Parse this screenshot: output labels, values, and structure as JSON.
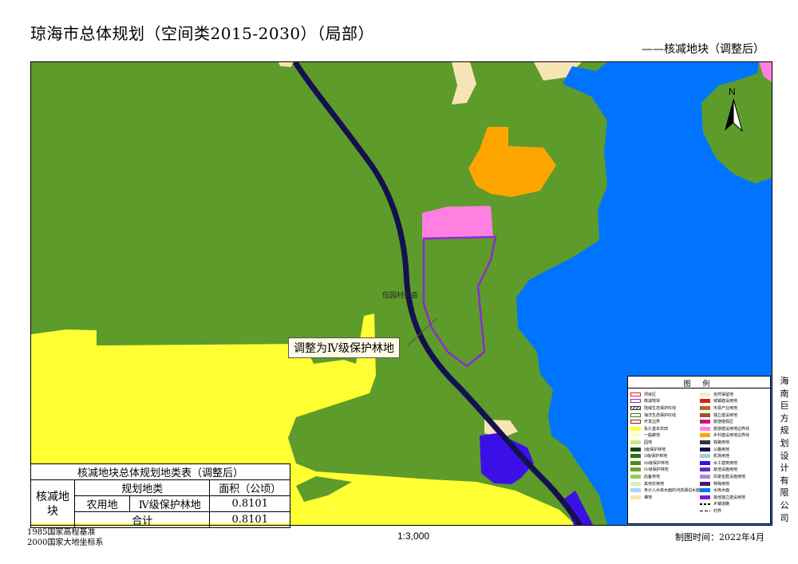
{
  "header": {
    "title": "琼海市总体规划（空间类2015-2030）（局部）",
    "subtitle": "——核减地块（调整后）"
  },
  "map": {
    "village_label": "伍园村委会",
    "callout": "调整为Ⅳ级保护林地",
    "north_label": "N",
    "colors": {
      "forest": "#5d9b2a",
      "water": "#0074ff",
      "farmland": "#ffff33",
      "orange": "#ffa500",
      "pink": "#ff80e0",
      "road": "#151050",
      "sand": "#f7e4b4",
      "boundary": "#8c2bd6",
      "blue_violet": "#3b10e8"
    }
  },
  "legend": {
    "title": "图 例",
    "left_items": [
      {
        "label": "项目区",
        "swatch": "outline-red"
      },
      {
        "label": "核减地块",
        "swatch": "outline-purple"
      },
      {
        "label": "陆域生态保护红线",
        "swatch": "hatch"
      },
      {
        "label": "海洋生态保护红线",
        "swatch": "outline-green"
      },
      {
        "label": "开发边界",
        "swatch": "outline-darkred"
      },
      {
        "label": "永久基本农田",
        "swatch": "#ffff33"
      },
      {
        "label": "一般耕地",
        "swatch": "#ffffbe"
      },
      {
        "label": "园地",
        "swatch": "#c8e98c"
      },
      {
        "label": "I级保护林地",
        "swatch": "#0f4a12"
      },
      {
        "label": "II级保护林地",
        "swatch": "#2e6e1c"
      },
      {
        "label": "III级保护林地",
        "swatch": "#4b8a25"
      },
      {
        "label": "IV级保护林地",
        "swatch": "#6aa52e"
      },
      {
        "label": "后备林地",
        "swatch": "#95cc5a"
      },
      {
        "label": "其他农用地",
        "swatch": "#d7eeb0"
      },
      {
        "label": "未计入水库水面的河流湖泊水面",
        "swatch": "#9fd8ff"
      },
      {
        "label": "裸地",
        "swatch": "#f7e4b4"
      }
    ],
    "right_items": [
      {
        "label": "自然保留地",
        "swatch": "#e8f5c8"
      },
      {
        "label": "城镇建设用地",
        "swatch": "#e31a1c"
      },
      {
        "label": "市县产业用地",
        "swatch": "#b5651d"
      },
      {
        "label": "独立建设用地",
        "swatch": "#a0522d"
      },
      {
        "label": "旅游度假区",
        "swatch": "#c71585"
      },
      {
        "label": "旅游建设用地边界线",
        "swatch": "#ff80e0"
      },
      {
        "label": "乡村建设用地边界线",
        "swatch": "#ffa500"
      },
      {
        "label": "铁路用地",
        "swatch": "#333333"
      },
      {
        "label": "公路用地",
        "swatch": "#151050"
      },
      {
        "label": "机场用地",
        "swatch": "#a6c8e0"
      },
      {
        "label": "水工建筑用地",
        "swatch": "#3b10e8"
      },
      {
        "label": "其他设施用地",
        "swatch": "#5a2bd6"
      },
      {
        "label": "风景名胜设施用地",
        "swatch": "#b083e0"
      },
      {
        "label": "特殊用地",
        "swatch": "#4b1870"
      },
      {
        "label": "水库水面",
        "swatch": "#0074ff"
      },
      {
        "label": "其他独立建设用地",
        "swatch": "#7a1fd6"
      },
      {
        "label": "乡镇道路",
        "swatch": "dash-thick"
      },
      {
        "label": "村界",
        "swatch": "dash-thin"
      }
    ]
  },
  "company": [
    "海",
    "南",
    "巨",
    "方",
    "规",
    "划",
    "设",
    "计",
    "有",
    "限",
    "公",
    "司"
  ],
  "table": {
    "title": "核减地块总体规划地类表（调整后）",
    "col_header_left": "核减地块",
    "col_header_class": "规划地类",
    "col_header_area": "面积（公顷）",
    "row_category": "农用地",
    "row_subcategory": "Ⅳ级保护林地",
    "row_area": "0.8101",
    "total_label": "合计",
    "total_area": "0.8101"
  },
  "footer": {
    "datum_line1": "1985国家高程基准",
    "datum_line2": "2000国家大地坐标系",
    "scale": "1:3,000",
    "date": "制图时间：2022年4月"
  }
}
